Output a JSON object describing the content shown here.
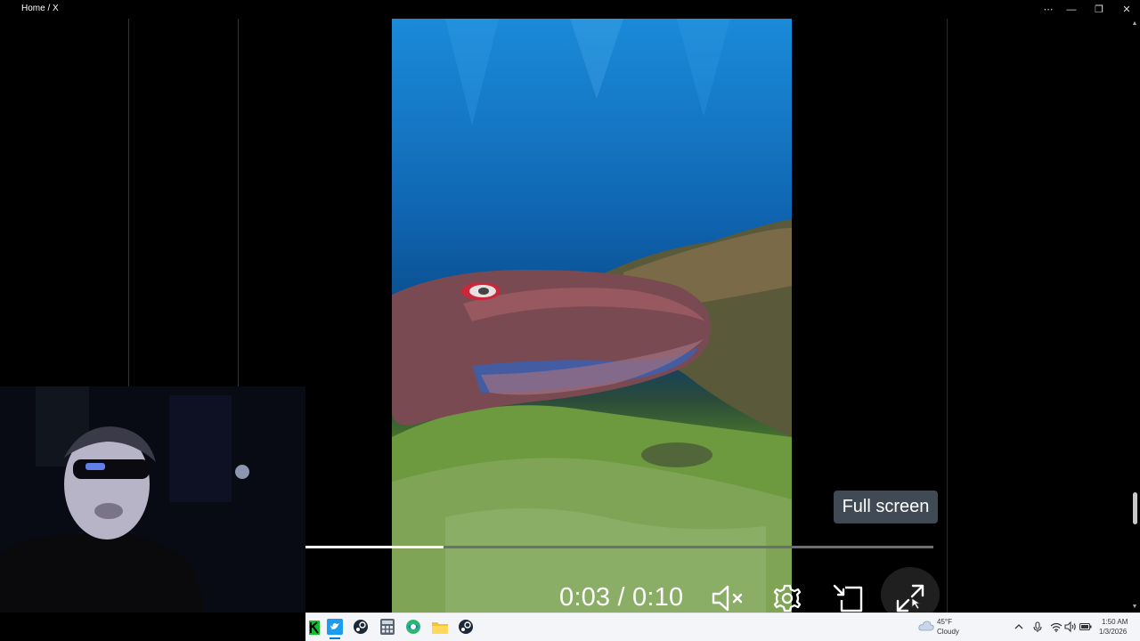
{
  "window": {
    "title": "Home / X",
    "controls": {
      "more": "⋯",
      "minimize": "—",
      "restore": "❐",
      "close": "✕"
    }
  },
  "video": {
    "current_time": "0:03",
    "separator": "/",
    "duration": "0:10",
    "progress_fraction": 0.22,
    "tooltip": "Full screen",
    "icons": [
      "mute-icon",
      "settings-icon",
      "rotate-icon",
      "fullscreen-icon"
    ]
  },
  "taskbar": {
    "apps": [
      "app-k-icon",
      "twitter-icon",
      "steam-icon",
      "calculator-icon",
      "browser-icon",
      "file-explorer-icon",
      "steam-icon"
    ],
    "weather": {
      "temp": "45°F",
      "condition": "Cloudy"
    },
    "clock": {
      "time": "1:50 AM",
      "date": "1/3/2026"
    },
    "tray_icons": [
      "chevron-up-icon",
      "microphone-icon",
      "wifi-icon",
      "volume-icon",
      "battery-icon"
    ]
  },
  "colors": {
    "taskbar_bg": "#f3f5f8",
    "tooltip_bg": "#3f4a55",
    "accent": "#0078d4"
  }
}
